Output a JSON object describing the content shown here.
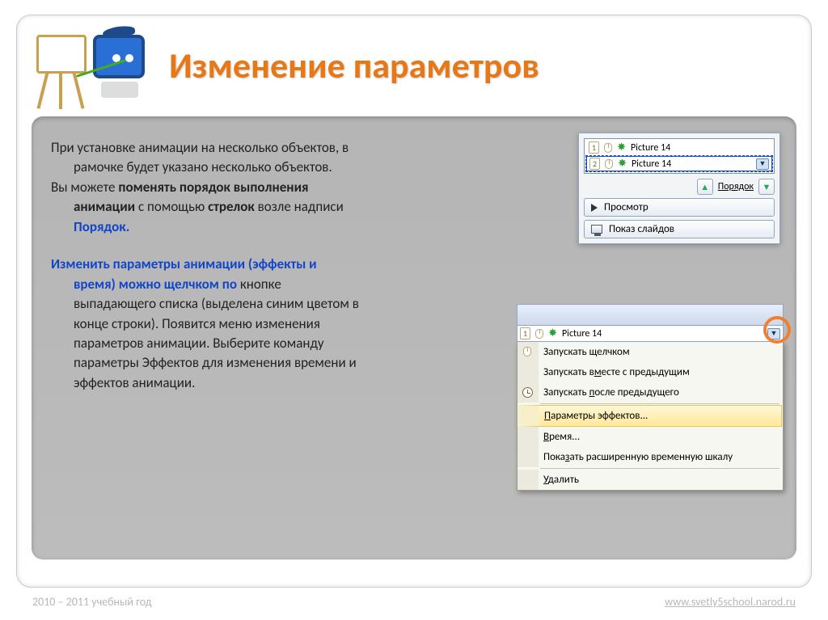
{
  "title": "Изменение параметров",
  "body": {
    "p1_a": "При установке анимации на несколько объектов, в",
    "p1_b": "рамочке будет указано несколько объектов.",
    "p2_a": "Вы можете ",
    "p2_bold1": "поменять порядок выполнения",
    "p2_b_line2_bold": "анимации",
    "p2_b_line2_mid": " с помощью ",
    "p2_bold2": "стрелок",
    "p2_b_line2_end": " возле надписи",
    "p2_blue": "Порядок.",
    "p3_blue_l1": "Изменить параметры анимации (эффекты и",
    "p3_blue_l2": "время) можно щелчком по",
    "p3_a": " кнопке",
    "p3_l3": "выпадающего списка (выделена синим цветом в",
    "p3_l4": "конце строки). Появится меню изменения",
    "p3_l5": "параметров анимации. Выберите команду",
    "p3_l6": "параметры Эффектов для изменения времени и",
    "p3_l7": "эффектов анимации."
  },
  "panel1": {
    "items": [
      {
        "n": "1",
        "label": "Picture 14"
      },
      {
        "n": "2",
        "label": "Picture 14"
      }
    ],
    "order_label": "Порядок",
    "preview": "Просмотр",
    "slideshow": "Показ слайдов"
  },
  "panel2": {
    "top_item": {
      "n": "1",
      "label": "Picture 14"
    },
    "menu": {
      "m1": "Запускать щелчком",
      "m2": "Запускать вместе с предыдущим",
      "m3": "Запускать после предыдущего",
      "m4_pre": "Параметры эффектов...",
      "m5": "Время...",
      "m6": "Показать расширенную временную шкалу",
      "m7": "Удалить"
    }
  },
  "footer": {
    "left": "2010 – 2011 учебный год",
    "right": "www.svetly5school.narod.ru"
  }
}
